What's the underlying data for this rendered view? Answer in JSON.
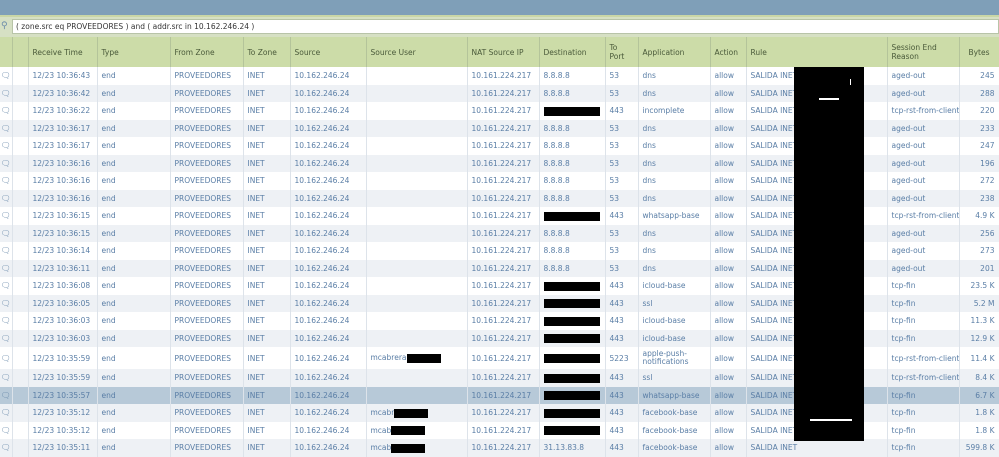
{
  "filter": {
    "query": "( zone.src eq PROVEEDORES ) and ( addr.src in 10.162.246.24 )",
    "icon": "search-icon"
  },
  "columns": [
    "",
    "",
    "Receive Time",
    "Type",
    "From Zone",
    "To Zone",
    "Source",
    "Source User",
    "NAT Source IP",
    "Destination",
    "To Port",
    "Application",
    "Action",
    "Rule",
    "Session End Reason",
    "Bytes"
  ],
  "rows": [
    {
      "time": "12/23 10:36:43",
      "type": "end",
      "from": "PROVEEDORES",
      "to": "INET",
      "src": "10.162.246.24",
      "user": "",
      "nat": "10.161.224.217",
      "dst": "8.8.8.8",
      "port": "53",
      "app": "dns",
      "action": "allow",
      "rule": "SALIDA INET",
      "reason": "aged-out",
      "bytes": "245"
    },
    {
      "time": "12/23 10:36:42",
      "type": "end",
      "from": "PROVEEDORES",
      "to": "INET",
      "src": "10.162.246.24",
      "user": "",
      "nat": "10.161.224.217",
      "dst": "8.8.8.8",
      "port": "53",
      "app": "dns",
      "action": "allow",
      "rule": "SALIDA INET",
      "reason": "aged-out",
      "bytes": "288"
    },
    {
      "time": "12/23 10:36:22",
      "type": "end",
      "from": "PROVEEDORES",
      "to": "INET",
      "src": "10.162.246.24",
      "user": "",
      "nat": "10.161.224.217",
      "dst": "",
      "dst_redacted": true,
      "port": "443",
      "app": "incomplete",
      "action": "allow",
      "rule": "SALIDA INET",
      "reason": "tcp-rst-from-client",
      "bytes": "220"
    },
    {
      "time": "12/23 10:36:17",
      "type": "end",
      "from": "PROVEEDORES",
      "to": "INET",
      "src": "10.162.246.24",
      "user": "",
      "nat": "10.161.224.217",
      "dst": "8.8.8.8",
      "port": "53",
      "app": "dns",
      "action": "allow",
      "rule": "SALIDA INET",
      "reason": "aged-out",
      "bytes": "233"
    },
    {
      "time": "12/23 10:36:17",
      "type": "end",
      "from": "PROVEEDORES",
      "to": "INET",
      "src": "10.162.246.24",
      "user": "",
      "nat": "10.161.224.217",
      "dst": "8.8.8.8",
      "port": "53",
      "app": "dns",
      "action": "allow",
      "rule": "SALIDA INET",
      "reason": "aged-out",
      "bytes": "247"
    },
    {
      "time": "12/23 10:36:16",
      "type": "end",
      "from": "PROVEEDORES",
      "to": "INET",
      "src": "10.162.246.24",
      "user": "",
      "nat": "10.161.224.217",
      "dst": "8.8.8.8",
      "port": "53",
      "app": "dns",
      "action": "allow",
      "rule": "SALIDA INET",
      "reason": "aged-out",
      "bytes": "196"
    },
    {
      "time": "12/23 10:36:16",
      "type": "end",
      "from": "PROVEEDORES",
      "to": "INET",
      "src": "10.162.246.24",
      "user": "",
      "nat": "10.161.224.217",
      "dst": "8.8.8.8",
      "port": "53",
      "app": "dns",
      "action": "allow",
      "rule": "SALIDA INET",
      "reason": "aged-out",
      "bytes": "272"
    },
    {
      "time": "12/23 10:36:16",
      "type": "end",
      "from": "PROVEEDORES",
      "to": "INET",
      "src": "10.162.246.24",
      "user": "",
      "nat": "10.161.224.217",
      "dst": "8.8.8.8",
      "port": "53",
      "app": "dns",
      "action": "allow",
      "rule": "SALIDA INET",
      "reason": "aged-out",
      "bytes": "238"
    },
    {
      "time": "12/23 10:36:15",
      "type": "end",
      "from": "PROVEEDORES",
      "to": "INET",
      "src": "10.162.246.24",
      "user": "",
      "nat": "10.161.224.217",
      "dst": "",
      "dst_redacted": true,
      "port": "443",
      "app": "whatsapp-base",
      "action": "allow",
      "rule": "SALIDA INET",
      "reason": "tcp-rst-from-client",
      "bytes": "4.9 K"
    },
    {
      "time": "12/23 10:36:15",
      "type": "end",
      "from": "PROVEEDORES",
      "to": "INET",
      "src": "10.162.246.24",
      "user": "",
      "nat": "10.161.224.217",
      "dst": "8.8.8.8",
      "port": "53",
      "app": "dns",
      "action": "allow",
      "rule": "SALIDA INET",
      "reason": "aged-out",
      "bytes": "256"
    },
    {
      "time": "12/23 10:36:14",
      "type": "end",
      "from": "PROVEEDORES",
      "to": "INET",
      "src": "10.162.246.24",
      "user": "",
      "nat": "10.161.224.217",
      "dst": "8.8.8.8",
      "port": "53",
      "app": "dns",
      "action": "allow",
      "rule": "SALIDA INET",
      "reason": "aged-out",
      "bytes": "273"
    },
    {
      "time": "12/23 10:36:11",
      "type": "end",
      "from": "PROVEEDORES",
      "to": "INET",
      "src": "10.162.246.24",
      "user": "",
      "nat": "10.161.224.217",
      "dst": "8.8.8.8",
      "port": "53",
      "app": "dns",
      "action": "allow",
      "rule": "SALIDA INET",
      "reason": "aged-out",
      "bytes": "201"
    },
    {
      "time": "12/23 10:36:08",
      "type": "end",
      "from": "PROVEEDORES",
      "to": "INET",
      "src": "10.162.246.24",
      "user": "",
      "nat": "10.161.224.217",
      "dst": "",
      "dst_redacted": true,
      "port": "443",
      "app": "icloud-base",
      "action": "allow",
      "rule": "SALIDA INET",
      "reason": "tcp-fin",
      "bytes": "23.5 K"
    },
    {
      "time": "12/23 10:36:05",
      "type": "end",
      "from": "PROVEEDORES",
      "to": "INET",
      "src": "10.162.246.24",
      "user": "",
      "nat": "10.161.224.217",
      "dst": "",
      "dst_redacted": true,
      "port": "443",
      "app": "ssl",
      "action": "allow",
      "rule": "SALIDA INET",
      "reason": "tcp-fin",
      "bytes": "5.2 M"
    },
    {
      "time": "12/23 10:36:03",
      "type": "end",
      "from": "PROVEEDORES",
      "to": "INET",
      "src": "10.162.246.24",
      "user": "",
      "nat": "10.161.224.217",
      "dst": "",
      "dst_redacted": true,
      "port": "443",
      "app": "icloud-base",
      "action": "allow",
      "rule": "SALIDA INET",
      "reason": "tcp-fin",
      "bytes": "11.3 K"
    },
    {
      "time": "12/23 10:36:03",
      "type": "end",
      "from": "PROVEEDORES",
      "to": "INET",
      "src": "10.162.246.24",
      "user": "",
      "nat": "10.161.224.217",
      "dst": "",
      "dst_redacted": true,
      "port": "443",
      "app": "icloud-base",
      "action": "allow",
      "rule": "SALIDA INET",
      "reason": "tcp-fin",
      "bytes": "12.9 K"
    },
    {
      "time": "12/23 10:35:59",
      "type": "end",
      "from": "PROVEEDORES",
      "to": "INET",
      "src": "10.162.246.24",
      "user": "mcabrera",
      "user_redacted": true,
      "nat": "10.161.224.217",
      "dst": "",
      "dst_redacted": true,
      "port": "5223",
      "app": "apple-push-notifications",
      "action": "allow",
      "rule": "SALIDA INET",
      "reason": "tcp-rst-from-client",
      "bytes": "11.4 K",
      "tall": true
    },
    {
      "time": "12/23 10:35:59",
      "type": "end",
      "from": "PROVEEDORES",
      "to": "INET",
      "src": "10.162.246.24",
      "user": "",
      "nat": "10.161.224.217",
      "dst": "",
      "dst_redacted": true,
      "port": "443",
      "app": "ssl",
      "action": "allow",
      "rule": "SALIDA INET",
      "reason": "tcp-rst-from-client",
      "bytes": "8.4 K"
    },
    {
      "time": "12/23 10:35:57",
      "type": "end",
      "from": "PROVEEDORES",
      "to": "INET",
      "src": "10.162.246.24",
      "user": "",
      "nat": "10.161.224.217",
      "dst": "",
      "dst_redacted": true,
      "port": "443",
      "app": "whatsapp-base",
      "action": "allow",
      "rule": "SALIDA INET",
      "reason": "tcp-fin",
      "bytes": "6.7 K",
      "selected": true
    },
    {
      "time": "12/23 10:35:12",
      "type": "end",
      "from": "PROVEEDORES",
      "to": "INET",
      "src": "10.162.246.24",
      "user": "mcabr",
      "user_redacted": true,
      "nat": "10.161.224.217",
      "dst": "",
      "dst_redacted": true,
      "port": "443",
      "app": "facebook-base",
      "action": "allow",
      "rule": "SALIDA INET",
      "reason": "tcp-fin",
      "bytes": "1.8 K"
    },
    {
      "time": "12/23 10:35:12",
      "type": "end",
      "from": "PROVEEDORES",
      "to": "INET",
      "src": "10.162.246.24",
      "user": "mcab",
      "user_redacted": true,
      "nat": "10.161.224.217",
      "dst": "",
      "dst_redacted": true,
      "port": "443",
      "app": "facebook-base",
      "action": "allow",
      "rule": "SALIDA INET",
      "reason": "tcp-fin",
      "bytes": "1.8 K"
    },
    {
      "time": "12/23 10:35:11",
      "type": "end",
      "from": "PROVEEDORES",
      "to": "INET",
      "src": "10.162.246.24",
      "user": "mcab",
      "user_redacted": true,
      "nat": "10.161.224.217",
      "dst": "31.13.83.8",
      "port": "443",
      "app": "facebook-base",
      "action": "allow",
      "rule": "SALIDA INET",
      "reason": "tcp-fin",
      "bytes": "599.8 K"
    }
  ]
}
